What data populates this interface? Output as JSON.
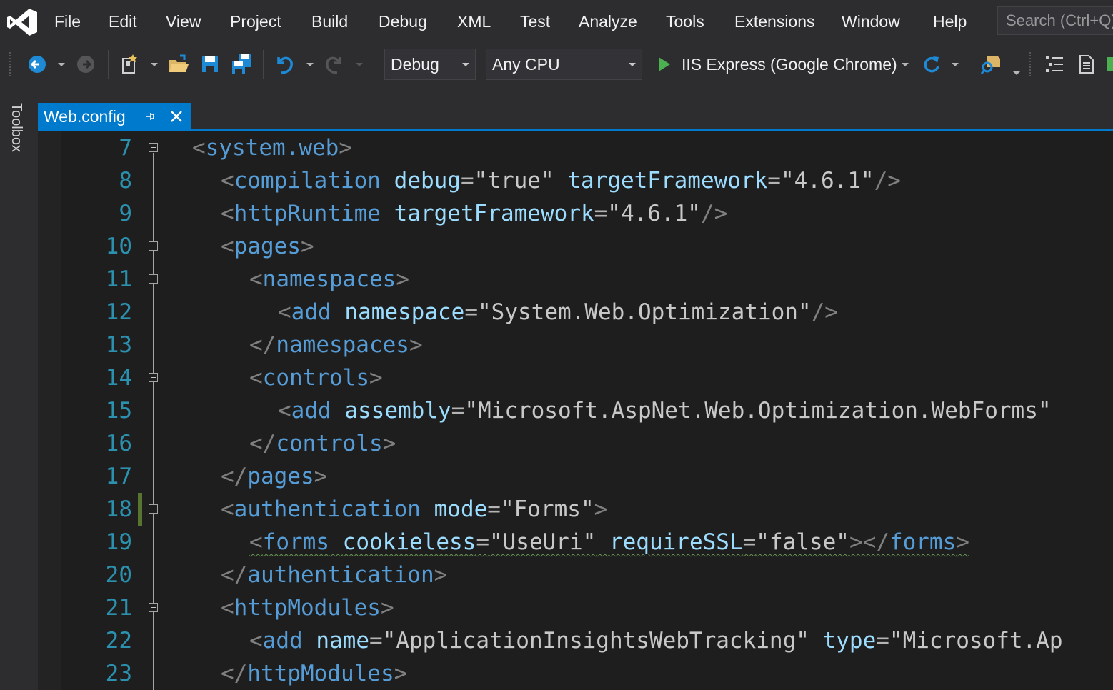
{
  "menu": {
    "items": [
      "File",
      "Edit",
      "View",
      "Project",
      "Build",
      "Debug",
      "XML",
      "Test",
      "Analyze",
      "Tools",
      "Extensions",
      "Window",
      "Help"
    ],
    "search_placeholder": "Search (Ctrl+Q)"
  },
  "toolbar": {
    "configuration": "Debug",
    "platform": "Any CPU",
    "run_target": "IIS Express (Google Chrome)",
    "icons": [
      "back-icon",
      "forward-icon",
      "new-project-icon",
      "open-file-icon",
      "save-icon",
      "save-all-icon",
      "undo-icon",
      "redo-icon",
      "start-icon",
      "refresh-icon",
      "find-in-files-icon",
      "list-icon",
      "document-icon"
    ]
  },
  "side": {
    "toolbox_label": "Toolbox"
  },
  "tab": {
    "title": "Web.config",
    "active": true
  },
  "colors": {
    "accent": "#007acc",
    "editor_bg": "#1e1e1e",
    "line_number": "#2b91af",
    "xml_tag": "#569cd6",
    "xml_attribute": "#9cdcfe",
    "xml_bracket": "#808080",
    "xml_value": "#c8c8c8",
    "change_marker": "#577430"
  },
  "editor": {
    "lines": [
      {
        "num": "7",
        "fold": true,
        "tokens": [
          [
            "b",
            "<"
          ],
          [
            "t",
            "system.web"
          ],
          [
            "b",
            ">"
          ]
        ]
      },
      {
        "num": "8",
        "fold": false,
        "tokens": [
          [
            "b",
            "<"
          ],
          [
            "t",
            "compilation"
          ],
          [
            "s",
            " "
          ],
          [
            "a",
            "debug"
          ],
          [
            "e",
            "="
          ],
          [
            "v",
            "\"true\""
          ],
          [
            "s",
            " "
          ],
          [
            "a",
            "targetFramework"
          ],
          [
            "e",
            "="
          ],
          [
            "v",
            "\"4.6.1\""
          ],
          [
            "b",
            "/>"
          ]
        ]
      },
      {
        "num": "9",
        "fold": false,
        "tokens": [
          [
            "b",
            "<"
          ],
          [
            "t",
            "httpRuntime"
          ],
          [
            "s",
            " "
          ],
          [
            "a",
            "targetFramework"
          ],
          [
            "e",
            "="
          ],
          [
            "v",
            "\"4.6.1\""
          ],
          [
            "b",
            "/>"
          ]
        ]
      },
      {
        "num": "10",
        "fold": true,
        "tokens": [
          [
            "b",
            "<"
          ],
          [
            "t",
            "pages"
          ],
          [
            "b",
            ">"
          ]
        ]
      },
      {
        "num": "11",
        "fold": true,
        "tokens": [
          [
            "b",
            "<"
          ],
          [
            "t",
            "namespaces"
          ],
          [
            "b",
            ">"
          ]
        ]
      },
      {
        "num": "12",
        "fold": false,
        "tokens": [
          [
            "b",
            "<"
          ],
          [
            "t",
            "add"
          ],
          [
            "s",
            " "
          ],
          [
            "a",
            "namespace"
          ],
          [
            "e",
            "="
          ],
          [
            "v",
            "\"System.Web.Optimization\""
          ],
          [
            "b",
            "/>"
          ]
        ]
      },
      {
        "num": "13",
        "fold": false,
        "tokens": [
          [
            "b",
            "</"
          ],
          [
            "t",
            "namespaces"
          ],
          [
            "b",
            ">"
          ]
        ]
      },
      {
        "num": "14",
        "fold": true,
        "tokens": [
          [
            "b",
            "<"
          ],
          [
            "t",
            "controls"
          ],
          [
            "b",
            ">"
          ]
        ]
      },
      {
        "num": "15",
        "fold": false,
        "tokens": [
          [
            "b",
            "<"
          ],
          [
            "t",
            "add"
          ],
          [
            "s",
            " "
          ],
          [
            "a",
            "assembly"
          ],
          [
            "e",
            "="
          ],
          [
            "v",
            "\"Microsoft.AspNet.Web.Optimization.WebForms\""
          ]
        ]
      },
      {
        "num": "16",
        "fold": false,
        "tokens": [
          [
            "b",
            "</"
          ],
          [
            "t",
            "controls"
          ],
          [
            "b",
            ">"
          ]
        ]
      },
      {
        "num": "17",
        "fold": false,
        "tokens": [
          [
            "b",
            "</"
          ],
          [
            "t",
            "pages"
          ],
          [
            "b",
            ">"
          ]
        ]
      },
      {
        "num": "18",
        "fold": true,
        "changed": true,
        "tokens": [
          [
            "b",
            "<"
          ],
          [
            "t",
            "authentication"
          ],
          [
            "s",
            " "
          ],
          [
            "a",
            "mode"
          ],
          [
            "e",
            "="
          ],
          [
            "v",
            "\"Forms\""
          ],
          [
            "b",
            ">"
          ]
        ]
      },
      {
        "num": "19",
        "fold": false,
        "squiggle": true,
        "tokens": [
          [
            "b",
            "<"
          ],
          [
            "t",
            "forms"
          ],
          [
            "s",
            " "
          ],
          [
            "a",
            "cookieless"
          ],
          [
            "e",
            "="
          ],
          [
            "v",
            "\"UseUri\""
          ],
          [
            "s",
            " "
          ],
          [
            "a",
            "requireSSL"
          ],
          [
            "e",
            "="
          ],
          [
            "v",
            "\"false\""
          ],
          [
            "b",
            "></"
          ],
          [
            "t",
            "forms"
          ],
          [
            "b",
            ">"
          ]
        ]
      },
      {
        "num": "20",
        "fold": false,
        "tokens": [
          [
            "b",
            "</"
          ],
          [
            "t",
            "authentication"
          ],
          [
            "b",
            ">"
          ]
        ]
      },
      {
        "num": "21",
        "fold": true,
        "tokens": [
          [
            "b",
            "<"
          ],
          [
            "t",
            "httpModules"
          ],
          [
            "b",
            ">"
          ]
        ]
      },
      {
        "num": "22",
        "fold": false,
        "tokens": [
          [
            "b",
            "<"
          ],
          [
            "t",
            "add"
          ],
          [
            "s",
            " "
          ],
          [
            "a",
            "name"
          ],
          [
            "e",
            "="
          ],
          [
            "v",
            "\"ApplicationInsightsWebTracking\""
          ],
          [
            "s",
            " "
          ],
          [
            "a",
            "type"
          ],
          [
            "e",
            "="
          ],
          [
            "v",
            "\"Microsoft.Ap"
          ]
        ]
      },
      {
        "num": "23",
        "fold": false,
        "tokens": [
          [
            "b",
            "</"
          ],
          [
            "t",
            "httpModules"
          ],
          [
            "b",
            ">"
          ]
        ]
      }
    ]
  }
}
